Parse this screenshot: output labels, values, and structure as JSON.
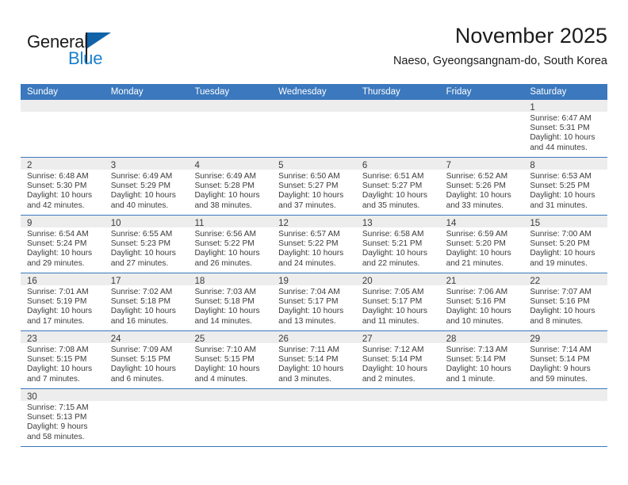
{
  "brand": {
    "name_part1": "General",
    "name_part2": "Blue",
    "flag_icon": "blue-flag-triangle",
    "accent_color": "#1b7fcb"
  },
  "header": {
    "title": "November 2025",
    "subtitle": "Naeso, Gyeongsangnam-do, South Korea"
  },
  "colors": {
    "header_row": "#3b78bd",
    "daynum_strip": "#ededed",
    "text": "#3b3b3b",
    "grid_line": "#3b78bd"
  },
  "weekdays": [
    "Sunday",
    "Monday",
    "Tuesday",
    "Wednesday",
    "Thursday",
    "Friday",
    "Saturday"
  ],
  "labels": {
    "sunrise_prefix": "Sunrise:",
    "sunset_prefix": "Sunset:",
    "daylight_prefix": "Daylight:"
  },
  "weeks": [
    [
      {
        "empty": true
      },
      {
        "empty": true
      },
      {
        "empty": true
      },
      {
        "empty": true
      },
      {
        "empty": true
      },
      {
        "empty": true
      },
      {
        "day": "1",
        "l1": "Sunrise: 6:47 AM",
        "l2": "Sunset: 5:31 PM",
        "l3": "Daylight: 10 hours",
        "l4": "and 44 minutes."
      }
    ],
    [
      {
        "day": "2",
        "l1": "Sunrise: 6:48 AM",
        "l2": "Sunset: 5:30 PM",
        "l3": "Daylight: 10 hours",
        "l4": "and 42 minutes."
      },
      {
        "day": "3",
        "l1": "Sunrise: 6:49 AM",
        "l2": "Sunset: 5:29 PM",
        "l3": "Daylight: 10 hours",
        "l4": "and 40 minutes."
      },
      {
        "day": "4",
        "l1": "Sunrise: 6:49 AM",
        "l2": "Sunset: 5:28 PM",
        "l3": "Daylight: 10 hours",
        "l4": "and 38 minutes."
      },
      {
        "day": "5",
        "l1": "Sunrise: 6:50 AM",
        "l2": "Sunset: 5:27 PM",
        "l3": "Daylight: 10 hours",
        "l4": "and 37 minutes."
      },
      {
        "day": "6",
        "l1": "Sunrise: 6:51 AM",
        "l2": "Sunset: 5:27 PM",
        "l3": "Daylight: 10 hours",
        "l4": "and 35 minutes."
      },
      {
        "day": "7",
        "l1": "Sunrise: 6:52 AM",
        "l2": "Sunset: 5:26 PM",
        "l3": "Daylight: 10 hours",
        "l4": "and 33 minutes."
      },
      {
        "day": "8",
        "l1": "Sunrise: 6:53 AM",
        "l2": "Sunset: 5:25 PM",
        "l3": "Daylight: 10 hours",
        "l4": "and 31 minutes."
      }
    ],
    [
      {
        "day": "9",
        "l1": "Sunrise: 6:54 AM",
        "l2": "Sunset: 5:24 PM",
        "l3": "Daylight: 10 hours",
        "l4": "and 29 minutes."
      },
      {
        "day": "10",
        "l1": "Sunrise: 6:55 AM",
        "l2": "Sunset: 5:23 PM",
        "l3": "Daylight: 10 hours",
        "l4": "and 27 minutes."
      },
      {
        "day": "11",
        "l1": "Sunrise: 6:56 AM",
        "l2": "Sunset: 5:22 PM",
        "l3": "Daylight: 10 hours",
        "l4": "and 26 minutes."
      },
      {
        "day": "12",
        "l1": "Sunrise: 6:57 AM",
        "l2": "Sunset: 5:22 PM",
        "l3": "Daylight: 10 hours",
        "l4": "and 24 minutes."
      },
      {
        "day": "13",
        "l1": "Sunrise: 6:58 AM",
        "l2": "Sunset: 5:21 PM",
        "l3": "Daylight: 10 hours",
        "l4": "and 22 minutes."
      },
      {
        "day": "14",
        "l1": "Sunrise: 6:59 AM",
        "l2": "Sunset: 5:20 PM",
        "l3": "Daylight: 10 hours",
        "l4": "and 21 minutes."
      },
      {
        "day": "15",
        "l1": "Sunrise: 7:00 AM",
        "l2": "Sunset: 5:20 PM",
        "l3": "Daylight: 10 hours",
        "l4": "and 19 minutes."
      }
    ],
    [
      {
        "day": "16",
        "l1": "Sunrise: 7:01 AM",
        "l2": "Sunset: 5:19 PM",
        "l3": "Daylight: 10 hours",
        "l4": "and 17 minutes."
      },
      {
        "day": "17",
        "l1": "Sunrise: 7:02 AM",
        "l2": "Sunset: 5:18 PM",
        "l3": "Daylight: 10 hours",
        "l4": "and 16 minutes."
      },
      {
        "day": "18",
        "l1": "Sunrise: 7:03 AM",
        "l2": "Sunset: 5:18 PM",
        "l3": "Daylight: 10 hours",
        "l4": "and 14 minutes."
      },
      {
        "day": "19",
        "l1": "Sunrise: 7:04 AM",
        "l2": "Sunset: 5:17 PM",
        "l3": "Daylight: 10 hours",
        "l4": "and 13 minutes."
      },
      {
        "day": "20",
        "l1": "Sunrise: 7:05 AM",
        "l2": "Sunset: 5:17 PM",
        "l3": "Daylight: 10 hours",
        "l4": "and 11 minutes."
      },
      {
        "day": "21",
        "l1": "Sunrise: 7:06 AM",
        "l2": "Sunset: 5:16 PM",
        "l3": "Daylight: 10 hours",
        "l4": "and 10 minutes."
      },
      {
        "day": "22",
        "l1": "Sunrise: 7:07 AM",
        "l2": "Sunset: 5:16 PM",
        "l3": "Daylight: 10 hours",
        "l4": "and 8 minutes."
      }
    ],
    [
      {
        "day": "23",
        "l1": "Sunrise: 7:08 AM",
        "l2": "Sunset: 5:15 PM",
        "l3": "Daylight: 10 hours",
        "l4": "and 7 minutes."
      },
      {
        "day": "24",
        "l1": "Sunrise: 7:09 AM",
        "l2": "Sunset: 5:15 PM",
        "l3": "Daylight: 10 hours",
        "l4": "and 6 minutes."
      },
      {
        "day": "25",
        "l1": "Sunrise: 7:10 AM",
        "l2": "Sunset: 5:15 PM",
        "l3": "Daylight: 10 hours",
        "l4": "and 4 minutes."
      },
      {
        "day": "26",
        "l1": "Sunrise: 7:11 AM",
        "l2": "Sunset: 5:14 PM",
        "l3": "Daylight: 10 hours",
        "l4": "and 3 minutes."
      },
      {
        "day": "27",
        "l1": "Sunrise: 7:12 AM",
        "l2": "Sunset: 5:14 PM",
        "l3": "Daylight: 10 hours",
        "l4": "and 2 minutes."
      },
      {
        "day": "28",
        "l1": "Sunrise: 7:13 AM",
        "l2": "Sunset: 5:14 PM",
        "l3": "Daylight: 10 hours",
        "l4": "and 1 minute."
      },
      {
        "day": "29",
        "l1": "Sunrise: 7:14 AM",
        "l2": "Sunset: 5:14 PM",
        "l3": "Daylight: 9 hours",
        "l4": "and 59 minutes."
      }
    ],
    [
      {
        "day": "30",
        "l1": "Sunrise: 7:15 AM",
        "l2": "Sunset: 5:13 PM",
        "l3": "Daylight: 9 hours",
        "l4": "and 58 minutes."
      },
      {
        "empty": true
      },
      {
        "empty": true
      },
      {
        "empty": true
      },
      {
        "empty": true
      },
      {
        "empty": true
      },
      {
        "empty": true
      }
    ]
  ]
}
